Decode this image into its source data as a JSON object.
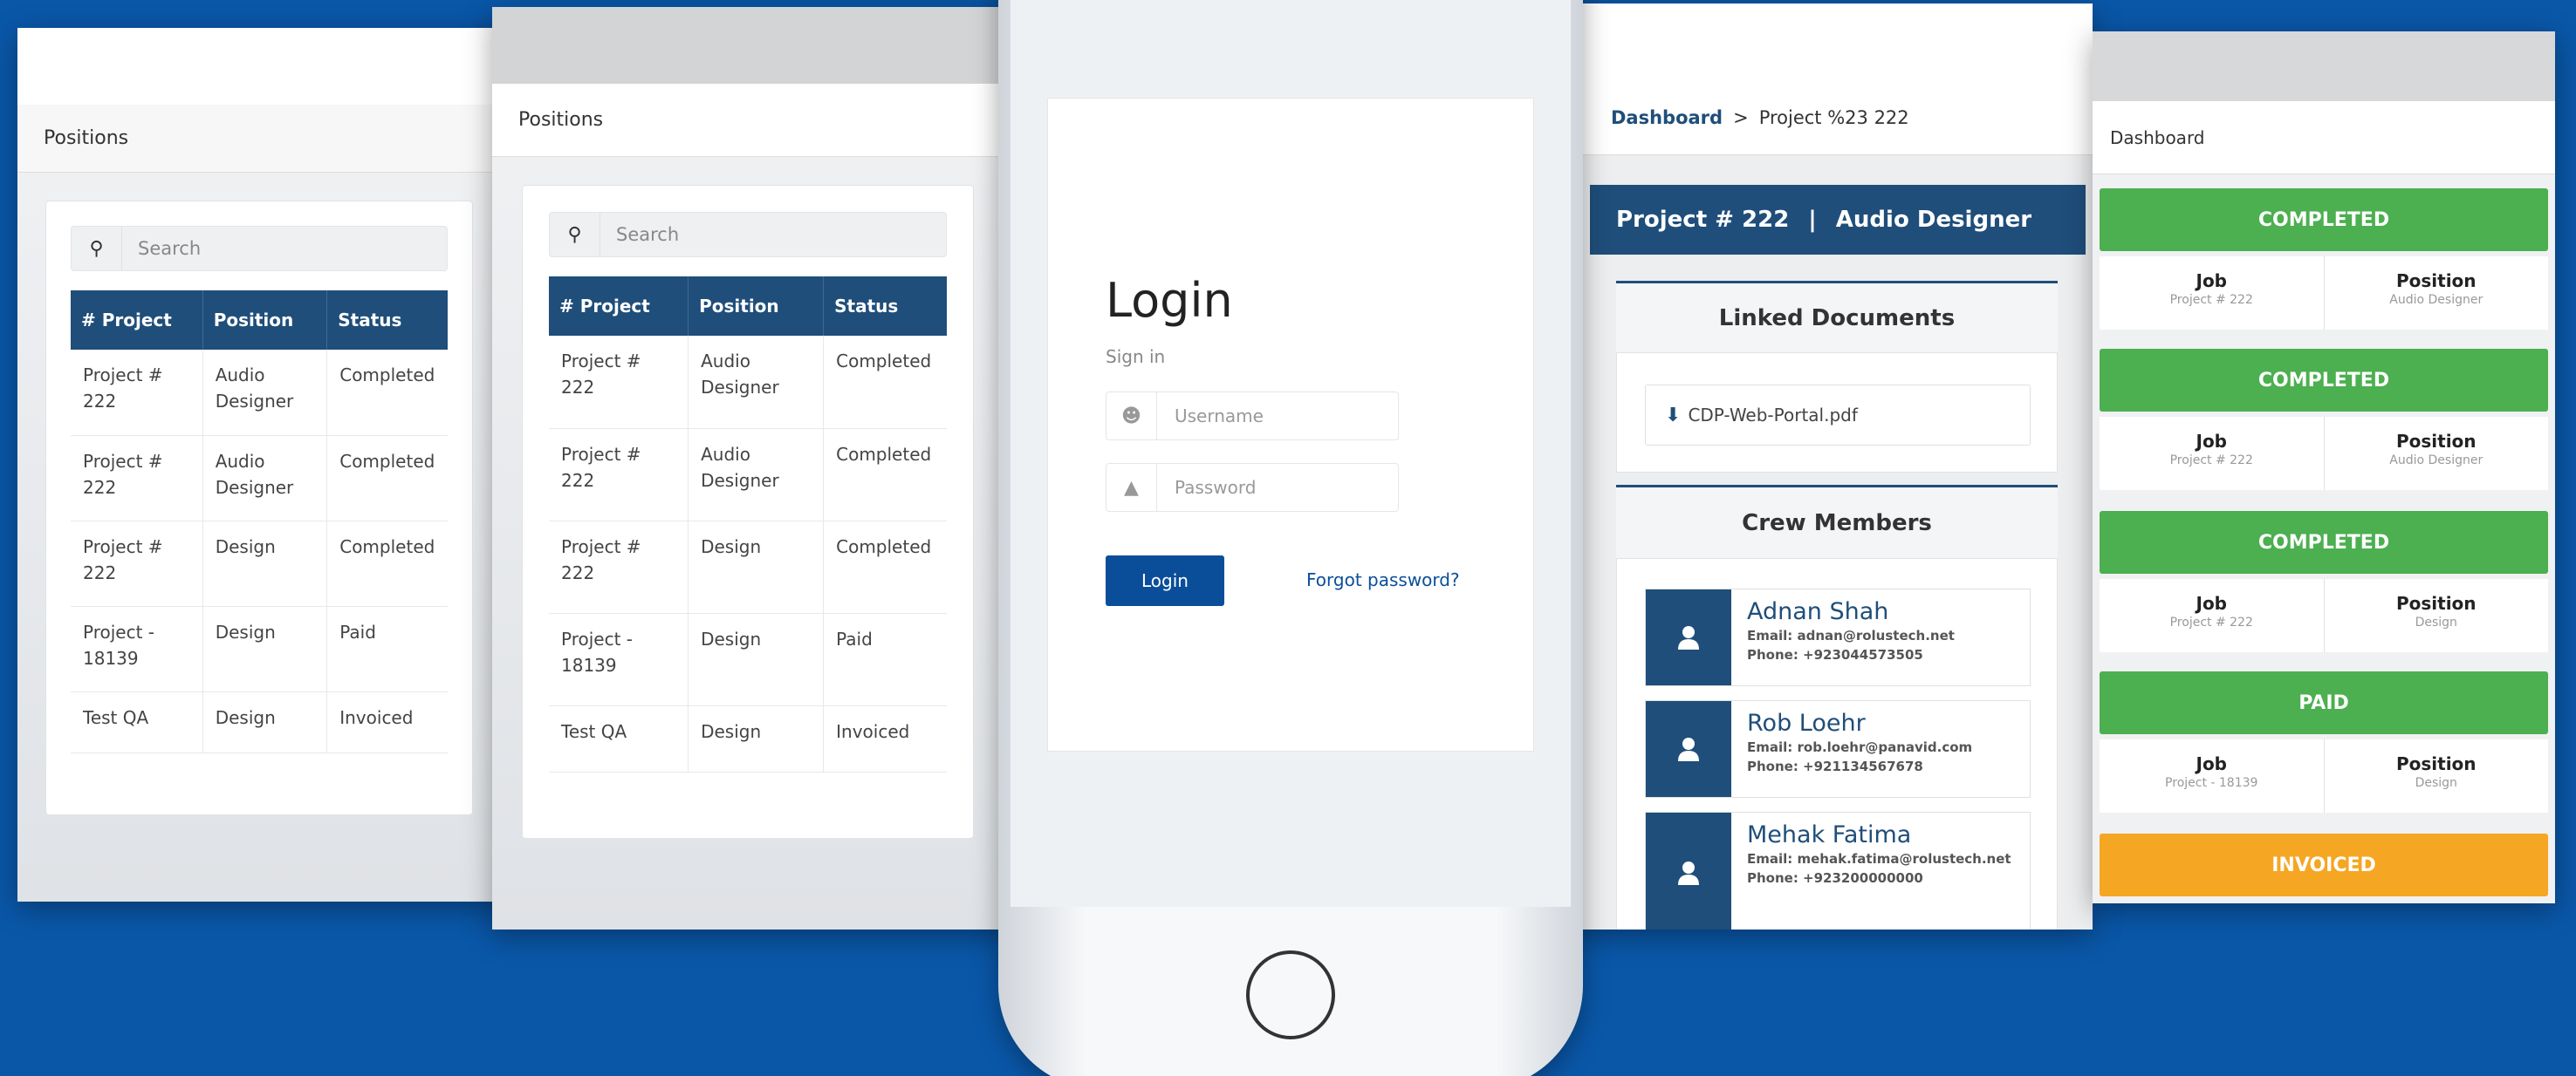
{
  "positions": {
    "title": "Positions",
    "search_placeholder": "Search",
    "columns": [
      "# Project",
      "Position",
      "Status"
    ],
    "rows": [
      [
        "Project # 222",
        "Audio Designer",
        "Completed"
      ],
      [
        "Project # 222",
        "Audio Designer",
        "Completed"
      ],
      [
        "Project # 222",
        "Design",
        "Completed"
      ],
      [
        "Project - 18139",
        "Design",
        "Paid"
      ],
      [
        "Test QA",
        "Design",
        "Invoiced"
      ]
    ]
  },
  "login": {
    "title": "Login",
    "subtitle": "Sign in",
    "username_placeholder": "Username",
    "password_placeholder": "Password",
    "login_button": "Login",
    "forgot_link": "Forgot password?"
  },
  "detail": {
    "breadcrumb_root": "Dashboard",
    "breadcrumb_sep": ">",
    "breadcrumb_current": "Project %23 222",
    "header_project": "Project # 222",
    "header_sep": "|",
    "header_position": "Audio Designer",
    "linked_documents_title": "Linked Documents",
    "document_name": "CDP-Web-Portal.pdf",
    "crew_title": "Crew Members",
    "crew": [
      {
        "name": "Adnan Shah",
        "email": "Email: adnan@rolustech.net",
        "phone": "Phone: +923044573505"
      },
      {
        "name": "Rob Loehr",
        "email": "Email: rob.loehr@panavid.com",
        "phone": "Phone: +921134567678"
      },
      {
        "name": "Mehak Fatima",
        "email": "Email: mehak.fatima@rolustech.net",
        "phone": "Phone: +923200000000"
      }
    ]
  },
  "dashboard": {
    "title": "Dashboard",
    "job_label": "Job",
    "position_label": "Position",
    "cards": [
      {
        "status": "COMPLETED",
        "color": "#4caf50",
        "job": "Project # 222",
        "position": "Audio Designer"
      },
      {
        "status": "COMPLETED",
        "color": "#4caf50",
        "job": "Project # 222",
        "position": "Audio Designer"
      },
      {
        "status": "COMPLETED",
        "color": "#4caf50",
        "job": "Project # 222",
        "position": "Design"
      },
      {
        "status": "PAID",
        "color": "#4caf50",
        "job": "Project - 18139",
        "position": "Design"
      },
      {
        "status": "INVOICED",
        "color": "#f5a623",
        "job": "",
        "position": ""
      }
    ]
  },
  "colors": {
    "background": "#0a57a8",
    "header": "#1f4e7a",
    "accent": "#0a4e9a"
  }
}
